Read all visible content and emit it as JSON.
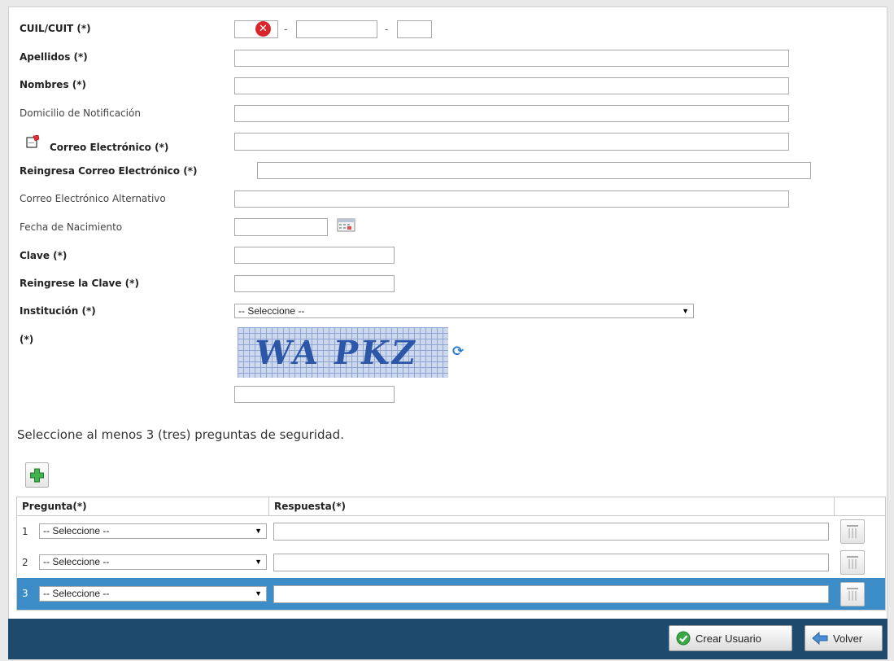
{
  "form": {
    "cuil_label": "CUIL/CUIT (*)",
    "cuil_sep": "-",
    "apellidos_label": "Apellidos (*)",
    "nombres_label": "Nombres (*)",
    "domicilio_label": "Domicilio de Notificación",
    "correo_label": "Correo Electrónico (*)",
    "reingresa_correo_label": "Reingresa Correo Electrónico (*)",
    "correo_alt_label": "Correo Electrónico Alternativo",
    "fecha_label": "Fecha de Nacimiento",
    "clave_label": "Clave (*)",
    "reingrese_clave_label": "Reingrese la Clave (*)",
    "institucion_label": "Institución (*)",
    "institucion_value": "-- Seleccione --",
    "captcha_label": "(*)",
    "captcha_text": "WA PKZ"
  },
  "security": {
    "instruction": "Seleccione al menos 3 (tres) preguntas de seguridad.",
    "col_pregunta": "Pregunta(*)",
    "col_respuesta": "Respuesta(*)",
    "rows": [
      {
        "num": "1",
        "value": "-- Seleccione --"
      },
      {
        "num": "2",
        "value": "-- Seleccione --"
      },
      {
        "num": "3",
        "value": "-- Seleccione --"
      }
    ]
  },
  "footer": {
    "crear_label": "Crear Usuario",
    "volver_label": "Volver"
  },
  "colors": {
    "footer_bar": "#1e4a6e",
    "selected_row": "#3b8cc7",
    "error_icon": "#d9262b"
  }
}
